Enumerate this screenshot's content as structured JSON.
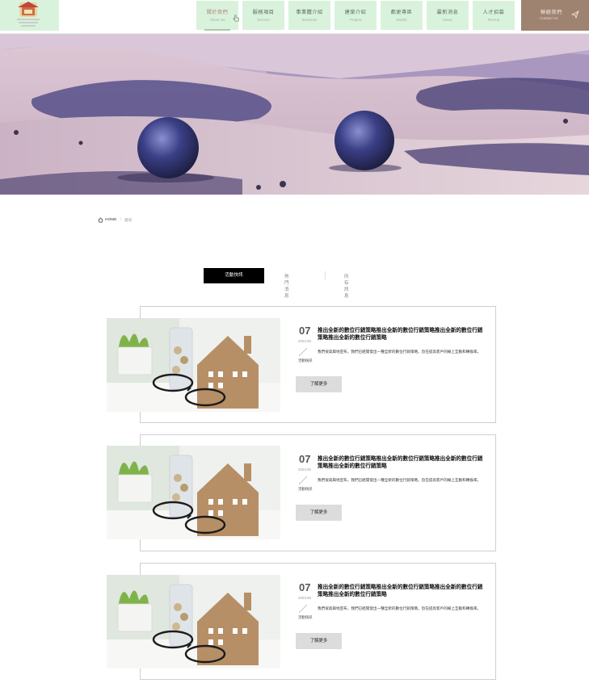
{
  "nav": {
    "items": [
      {
        "zh": "關於我們",
        "en": "About Us",
        "active": true
      },
      {
        "zh": "服務項目",
        "en": "Service",
        "active": false
      },
      {
        "zh": "事業體介紹",
        "en": "Business",
        "active": false
      },
      {
        "zh": "建案介紹",
        "en": "Project",
        "active": false
      },
      {
        "zh": "都更專區",
        "en": "Works",
        "active": false
      },
      {
        "zh": "最新消息",
        "en": "News",
        "active": false
      },
      {
        "zh": "人才招募",
        "en": "Recruit",
        "active": false
      }
    ],
    "contact": {
      "zh": "聯絡我們",
      "en": "Contact Us"
    }
  },
  "breadcrumb": {
    "home": "HOME",
    "current": "最新"
  },
  "tabs": [
    "活動快訊",
    "熱門消息",
    "所有訊息"
  ],
  "news": [
    {
      "day": "07",
      "ym": "2023.08",
      "category": "活動快訊",
      "title": "推出全新的數位行銷策略推出全新的數位行銷策略推出全新的數位行銷策略推出全新的數位行銷策略",
      "desc": "我們很高興地宣布，我們已經開發出一種全新的數位行銷策略，旨在提高客戶的線上互動和轉換率。",
      "more": "了解更多"
    },
    {
      "day": "07",
      "ym": "2023.08",
      "category": "活動快訊",
      "title": "推出全新的數位行銷策略推出全新的數位行銷策略推出全新的數位行銷策略推出全新的數位行銷策略",
      "desc": "我們很高興地宣布，我們已經開發出一種全新的數位行銷策略，旨在提高客戶的線上互動和轉換率。",
      "more": "了解更多"
    },
    {
      "day": "07",
      "ym": "2023.08",
      "category": "活動快訊",
      "title": "推出全新的數位行銷策略推出全新的數位行銷策略推出全新的數位行銷策略推出全新的數位行銷策略",
      "desc": "我們很高興地宣布，我們已經開發出一種全新的數位行銷策略，旨在提高客戶的線上互動和轉換率。",
      "more": "了解更多"
    }
  ],
  "colors": {
    "nav_bg": "#d9f2dc",
    "contact_bg": "#9e8371",
    "active_tab_bg": "#000000",
    "more_button_bg": "#dcdcdc"
  },
  "icons": [
    "logo-emblem",
    "pointer-hand-icon",
    "paper-plane-icon",
    "home-icon"
  ]
}
